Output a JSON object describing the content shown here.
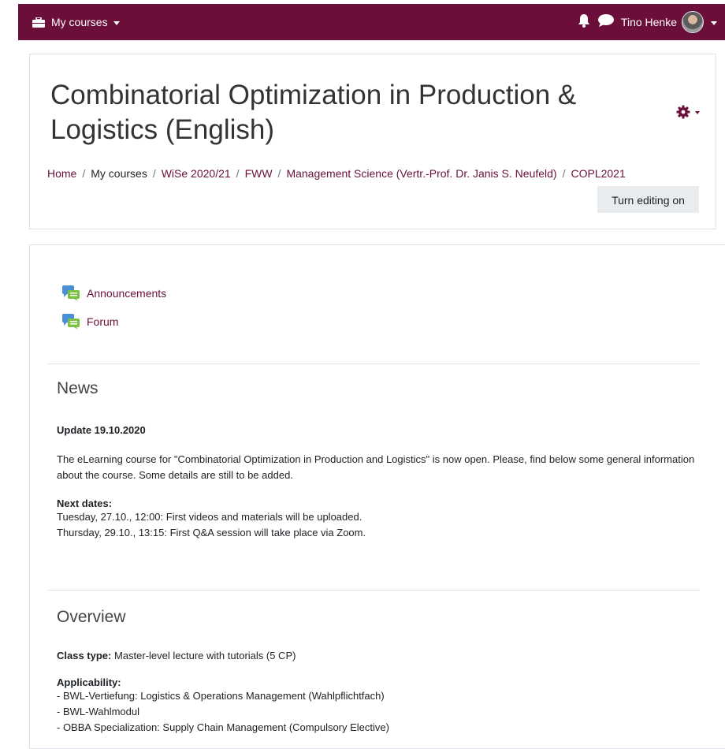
{
  "navbar": {
    "my_courses_label": "My courses",
    "user_name": "Tino Henke",
    "bg_color": "#6b0f3a"
  },
  "header": {
    "title": "Combinatorial Optimization in Production & Logistics (English)",
    "breadcrumb": [
      {
        "label": "Home"
      },
      {
        "label": "My courses"
      },
      {
        "label": "WiSe 2020/21"
      },
      {
        "label": "FWW"
      },
      {
        "label": "Management Science (Vertr.-Prof. Dr. Janis S. Neufeld)"
      },
      {
        "label": "COPL2021"
      }
    ],
    "editing_button": "Turn editing on"
  },
  "activities": [
    {
      "label": "Announcements",
      "icon": "forum-icon"
    },
    {
      "label": "Forum",
      "icon": "forum-icon"
    }
  ],
  "news": {
    "title": "News",
    "update_heading": "Update 19.10.2020",
    "body": "The eLearning course for \"Combinatorial Optimization in Production and Logistics\" is now open. Please, find below some general information about the course. Some details are still to be added.",
    "next_dates_heading": "Next dates:",
    "dates": [
      "Tuesday, 27.10., 12:00: First videos and materials will be uploaded.",
      "Thursday, 29.10., 13:15: First Q&A session will take place via Zoom."
    ]
  },
  "overview": {
    "title": "Overview",
    "class_type_label": "Class type:",
    "class_type_value": " Master-level lecture with tutorials (5 CP)",
    "applicability_heading": "Applicability:",
    "applicability": [
      "- BWL-Vertiefung: Logistics & Operations Management (Wahlpflichtfach)",
      "- BWL-Wahlmodul",
      "- OBBA Specialization: Supply Chain Management (Compulsory Elective)"
    ]
  }
}
